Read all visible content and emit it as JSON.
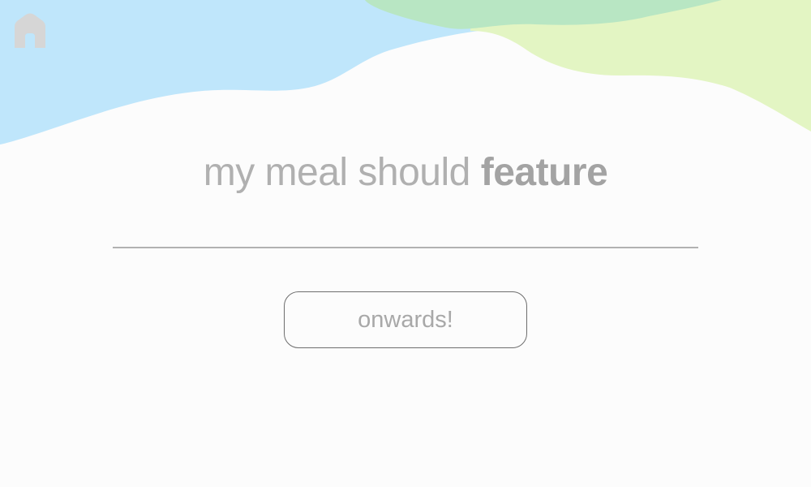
{
  "colors": {
    "background": "#fcfcfc",
    "wave_blue": "#bfe6fb",
    "wave_green": "#b8e6c3",
    "wave_lime": "#e3f5c3",
    "home_icon": "#d6d6d6",
    "text": "#b0b0b0"
  },
  "header": {
    "home_icon": "home-icon"
  },
  "prompt": {
    "text_light": "my meal should ",
    "text_bold": "feature"
  },
  "answer": {
    "value": "",
    "placeholder": ""
  },
  "actions": {
    "onwards_label": "onwards!"
  }
}
